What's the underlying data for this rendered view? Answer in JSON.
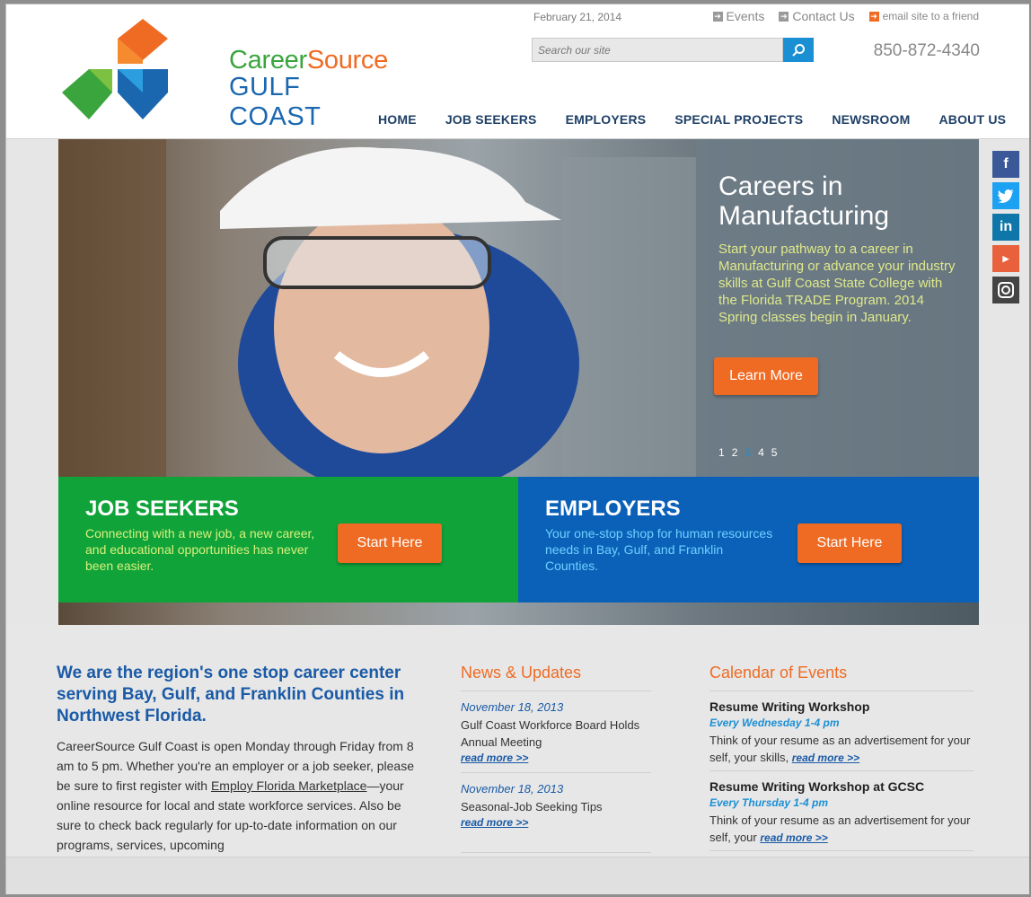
{
  "header": {
    "logo_line1_a": "Career",
    "logo_line1_b": "Source",
    "logo_line2": "GULF COAST",
    "date": "February 21, 2014",
    "toplinks": {
      "events": "Events",
      "contact": "Contact Us",
      "email": "email site to a friend"
    },
    "search_placeholder": "Search our site",
    "phone": "850-872-4340",
    "nav": [
      "HOME",
      "JOB SEEKERS",
      "EMPLOYERS",
      "SPECIAL PROJECTS",
      "NEWSROOM",
      "ABOUT US"
    ]
  },
  "hero": {
    "title": "Careers in Manufacturing",
    "description": "Start your pathway to a career in Manufacturing or advance your industry skills at Gulf Coast State College with the Florida TRADE Program. 2014 Spring classes begin in January.",
    "button": "Learn More",
    "pages": [
      "1",
      "2",
      "3",
      "4",
      "5"
    ],
    "active_page": "3"
  },
  "boxes": {
    "jobseekers": {
      "title": "JOB SEEKERS",
      "desc": "Connecting with a new job, a new career, and educational opportunities has never been easier.",
      "button": "Start Here"
    },
    "employers": {
      "title": "EMPLOYERS",
      "desc": "Your one-stop shop for human resources needs in Bay, Gulf, and Franklin Counties.",
      "button": "Start Here"
    }
  },
  "social": [
    "facebook-icon",
    "twitter-icon",
    "linkedin-icon",
    "youtube-icon",
    "instagram-icon"
  ],
  "intro": {
    "heading": "We are the region's one stop career center serving Bay, Gulf, and Franklin Counties in Northwest Florida.",
    "body_pre": "CareerSource Gulf Coast is open Monday through Friday from 8 am to 5 pm. Whether you're an employer or a job seeker, please be sure to first register with ",
    "body_link": "Employ Florida Marketplace",
    "body_post": "—your online resource for local and state workforce services. Also be sure to check back regularly for up-to-date information on our programs, services, upcoming"
  },
  "news": {
    "heading": "News & Updates",
    "items": [
      {
        "date": "November 18, 2013",
        "text": "Gulf Coast Workforce Board Holds Annual Meeting",
        "more": "read more >>"
      },
      {
        "date": "November 18, 2013",
        "text": "Seasonal-Job Seeking Tips",
        "more": "read more >>"
      }
    ]
  },
  "calendar": {
    "heading": "Calendar of Events",
    "items": [
      {
        "title": "Resume Writing Workshop",
        "when": "Every Wednesday 1-4 pm",
        "desc": "Think of your resume as an advertisement for your self, your skills, ",
        "more": "read more >>"
      },
      {
        "title": "Resume Writing Workshop at GCSC",
        "when": "Every Thursday 1-4 pm",
        "desc": "Think of your resume as an advertisement for your self, your ",
        "more": "read more >>"
      }
    ]
  },
  "colors": {
    "orange": "#ef6b23",
    "green": "#10a33a",
    "blue": "#0b61b8",
    "navy": "#1a5aa6"
  }
}
